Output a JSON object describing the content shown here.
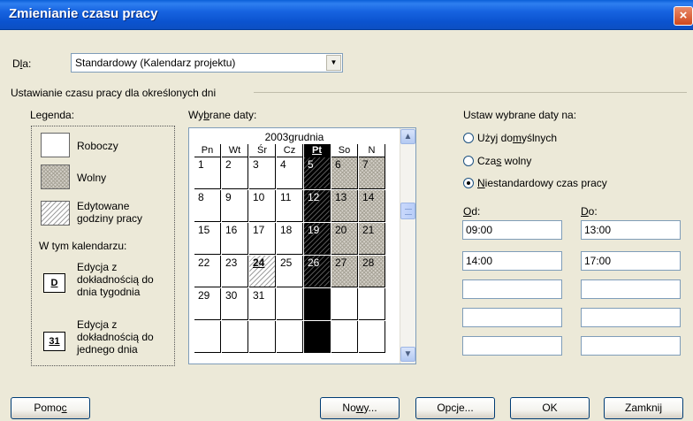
{
  "window": {
    "title": "Zmienianie czasu pracy",
    "close_glyph": "×"
  },
  "for": {
    "label_pre": "D",
    "label_u": "l",
    "label_post": "a:",
    "value": "Standardowy (Kalendarz projektu)"
  },
  "group_title": "Ustawianie czasu pracy dla określonych dni",
  "legend": {
    "title": "Legenda:",
    "working": "Roboczy",
    "nonworking": "Wolny",
    "edited_line1": "Edytowane",
    "edited_line2": "godziny pracy",
    "in_calendar": "W tym kalendarzu:",
    "weekday_glyph": "D",
    "weekday_l1": "Edycja z",
    "weekday_l2": "dokładnością do",
    "weekday_l3": "dnia tygodnia",
    "day_glyph": "31",
    "day_l1": "Edycja z",
    "day_l2": "dokładnością do",
    "day_l3": "jednego dnia"
  },
  "selected_dates": {
    "label_pre": "Wy",
    "label_u": "b",
    "label_post": "rane daty:"
  },
  "calendar": {
    "month": "2003grudnia",
    "headers": [
      "Pn",
      "Wt",
      "Śr",
      "Cz",
      "Pt",
      "So",
      "N"
    ],
    "rows": [
      [
        "1",
        "2",
        "3",
        "4",
        "5",
        "6",
        "7"
      ],
      [
        "8",
        "9",
        "10",
        "11",
        "12",
        "13",
        "14"
      ],
      [
        "15",
        "16",
        "17",
        "18",
        "19",
        "20",
        "21"
      ],
      [
        "22",
        "23",
        "24",
        "25",
        "26",
        "27",
        "28"
      ],
      [
        "29",
        "30",
        "31",
        "",
        "",
        "",
        ""
      ],
      [
        "",
        "",
        "",
        "",
        "",
        "",
        ""
      ]
    ]
  },
  "set_dates": {
    "title": "Ustaw wybrane daty na:",
    "opt_default_pre": "Użyj do",
    "opt_default_u": "m",
    "opt_default_post": "yślnych",
    "opt_nonworking_pre": "Cza",
    "opt_nonworking_u": "s",
    "opt_nonworking_post": " wolny",
    "opt_custom_u": "N",
    "opt_custom_post": "iestandardowy czas pracy",
    "from_label_u": "O",
    "from_label_post": "d:",
    "to_label_u": "D",
    "to_label_post": "o:",
    "from": [
      "09:00",
      "14:00",
      "",
      "",
      ""
    ],
    "to": [
      "13:00",
      "17:00",
      "",
      "",
      ""
    ]
  },
  "buttons": {
    "help_pre": "Pomo",
    "help_u": "c",
    "new_pre": "No",
    "new_u": "w",
    "new_post": "y...",
    "options_pre": "Opc",
    "options_u": "j",
    "options_post": "e...",
    "ok": "OK",
    "close": "Zamknij"
  }
}
